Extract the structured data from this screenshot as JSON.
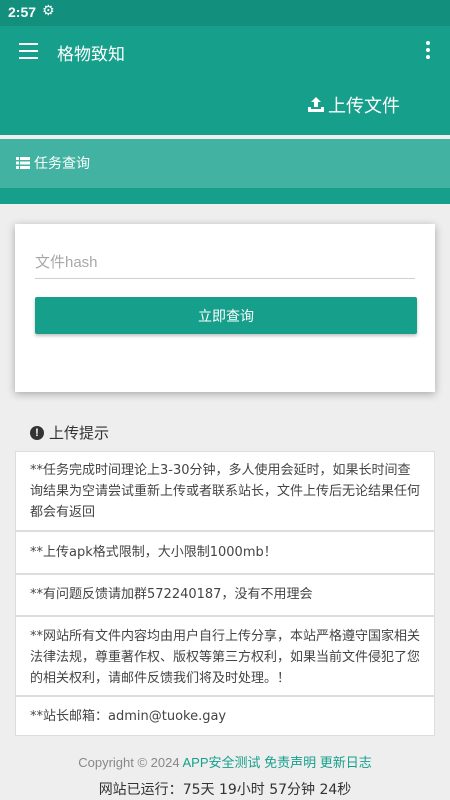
{
  "status_bar": {
    "time": "2:57",
    "settings_icon": "gear-icon"
  },
  "app_bar": {
    "title": "格物致知",
    "menu_icon": "hamburger-icon",
    "more_icon": "more-vert-icon"
  },
  "upload": {
    "label": "上传文件",
    "icon": "upload-icon"
  },
  "query_section": {
    "label": "任务查询",
    "icon": "list-icon"
  },
  "form": {
    "placeholder": "文件hash",
    "value": "",
    "submit_label": "立即查询"
  },
  "tips": {
    "title": "上传提示",
    "items": [
      "**任务完成时间理论上3-30分钟，多人使用会延时，如果长时间查询结果为空请尝试重新上传或者联系站长，文件上传后无论结果任何都会有返回",
      "**上传apk格式限制，大小限制1000mb！",
      "**有问题反馈请加群572240187，没有不用理会",
      "**网站所有文件内容均由用户自行上传分享，本站严格遵守国家相关法律法规，尊重著作权、版权等第三方权利，如果当前文件侵犯了您的相关权利，请邮件反馈我们将及时处理。！",
      "**站长邮箱：admin@tuoke.gay"
    ]
  },
  "footer": {
    "copyright": "Copyright © 2024",
    "links": [
      "APP安全测试",
      "免责声明",
      "更新日志"
    ],
    "uptime_label": "网站已运行：",
    "uptime_value": "75天 19小时 57分钟 24秒"
  },
  "colors": {
    "primary": "#16a08c",
    "status_bar": "#138f7e",
    "query_band": "#42b2a2"
  }
}
